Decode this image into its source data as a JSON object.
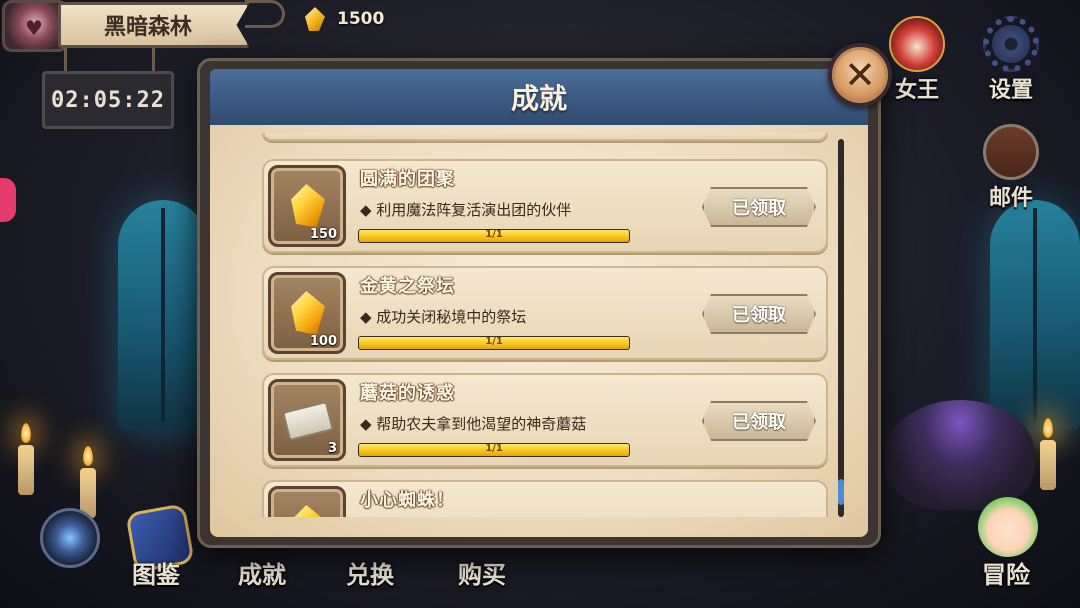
{
  "location": {
    "name": "黑暗森林"
  },
  "timer": {
    "value": "02:05:22"
  },
  "currency": {
    "amount": "1500",
    "icon": "gold-gem-icon"
  },
  "side_menu": {
    "queen": "女王",
    "settings": "设置",
    "mail": "邮件"
  },
  "modal": {
    "title": "成就",
    "close_icon": "close-x-icon",
    "achievements": [
      {
        "title": "圆满的团聚",
        "description": "◆ 利用魔法阵复活演出团的伙伴",
        "reward_icon": "gold-gem-icon",
        "reward_qty": "150",
        "progress_text": "1/1",
        "progress_fraction": 1.0,
        "button_label": "已领取"
      },
      {
        "title": "金黄之祭坛",
        "description": "◆ 成功关闭秘境中的祭坛",
        "reward_icon": "gold-gem-icon",
        "reward_qty": "100",
        "progress_text": "1/1",
        "progress_fraction": 1.0,
        "button_label": "已领取"
      },
      {
        "title": "蘑菇的诱惑",
        "description": "◆ 帮助农夫拿到他渴望的神奇蘑菇",
        "reward_icon": "ticket-icon",
        "reward_qty": "3",
        "progress_text": "1/1",
        "progress_fraction": 1.0,
        "button_label": "已领取"
      },
      {
        "title": "小心蜘蛛！",
        "reward_icon": "gold-gem-icon"
      }
    ]
  },
  "bottom_nav": {
    "codex": "图鉴",
    "achievements": "成就",
    "exchange": "兑换",
    "shop": "购买",
    "adventure": "冒险"
  }
}
